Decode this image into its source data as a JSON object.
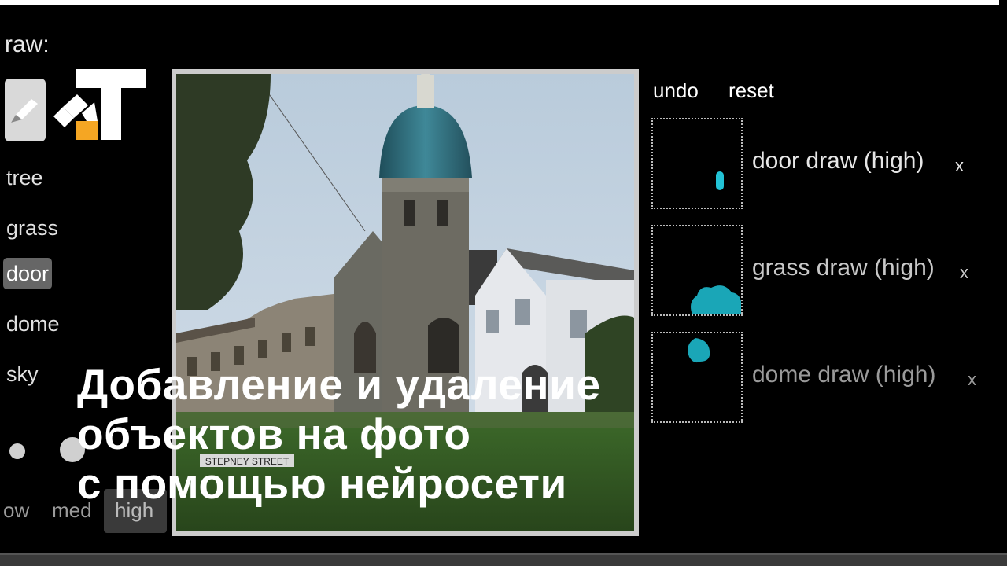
{
  "header": {
    "draw_label": "raw:"
  },
  "logo": {
    "name": "T-logo"
  },
  "objects": [
    {
      "label": "tree"
    },
    {
      "label": "grass"
    },
    {
      "label": "door"
    },
    {
      "label": "dome"
    },
    {
      "label": "sky"
    }
  ],
  "brush_sizes": [
    {
      "label": "ow"
    },
    {
      "label": "med"
    },
    {
      "label": "high"
    }
  ],
  "controls": {
    "undo": "undo",
    "reset": "reset"
  },
  "layers": [
    {
      "label": "door draw (high)",
      "remove": "x"
    },
    {
      "label": "grass draw (high)",
      "remove": "x"
    },
    {
      "label": "dome draw (high)",
      "remove": "x"
    }
  ],
  "headline": {
    "line1": "Добавление и удаление",
    "line2": "объектов на фото",
    "line3": "с помощью нейросети"
  },
  "photo": {
    "sign_text": "STEPNEY STREET"
  },
  "colors": {
    "accent": "#1aa6b7",
    "logo_orange": "#f5a623",
    "selected_bg": "#666666"
  }
}
